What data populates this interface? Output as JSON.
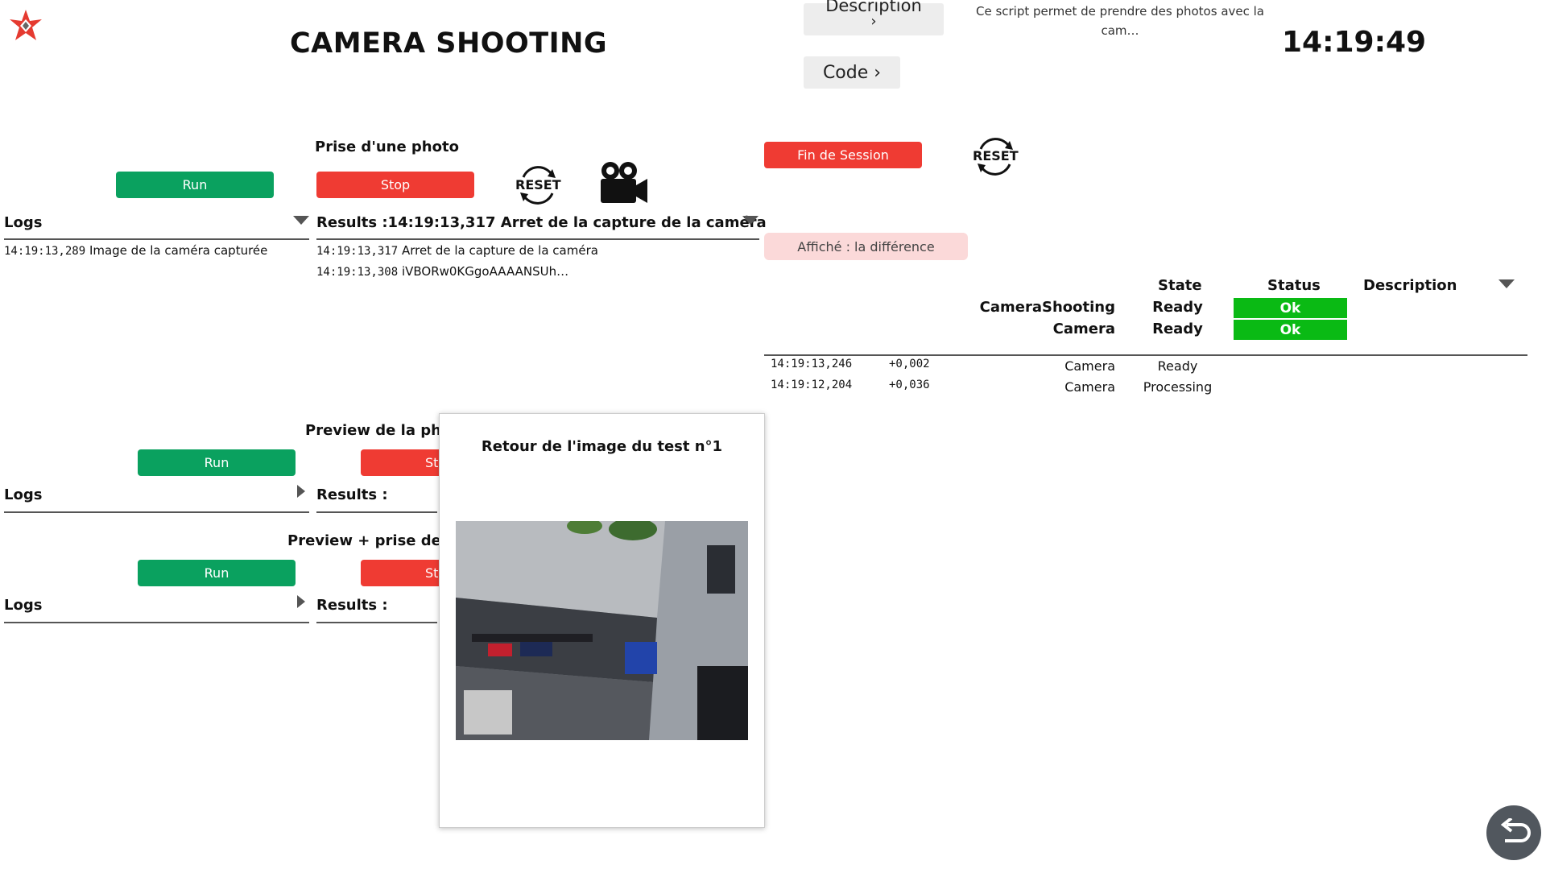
{
  "header": {
    "title": "CAMERA SHOOTING",
    "description_label": "Description",
    "description_chevron": "›",
    "description_text": "Ce script permet de prendre des photos avec la cam…",
    "code_label": "Code ›",
    "clock": "14:19:49"
  },
  "section1": {
    "title": "Prise d'une photo",
    "run_label": "Run",
    "stop_label": "Stop",
    "reset_text": "RESET",
    "logs_label": "Logs",
    "logs": [
      {
        "time": "14:19:13,289",
        "text": "Image de la caméra capturée"
      }
    ],
    "results_label": "Results :14:19:13,317 Arret de la capture de la caméra",
    "results": [
      {
        "time": "14:19:13,317",
        "text": "Arret de la capture de la caméra"
      },
      {
        "time": "14:19:13,308",
        "text": "iVBORw0KGgoAAAANSUh…"
      }
    ]
  },
  "section2": {
    "title": "Preview de la pho",
    "run_label": "Run",
    "stop_label": "St",
    "logs_label": "Logs",
    "results_label": "Results :"
  },
  "section3": {
    "title": "Preview + prise de p",
    "run_label": "Run",
    "stop_label": "St",
    "logs_label": "Logs",
    "results_label": "Results :"
  },
  "session": {
    "end_label": "Fin de Session",
    "reset_text": "RESET",
    "diff_label": "Affiché : la différence"
  },
  "status_table": {
    "headers": {
      "state": "State",
      "status": "Status",
      "description": "Description"
    },
    "rows": [
      {
        "name": "CameraShooting",
        "state": "Ready",
        "status": "Ok"
      },
      {
        "name": "Camera",
        "state": "Ready",
        "status": "Ok"
      }
    ],
    "log": [
      {
        "time": "14:19:13,246",
        "delta": "+0,002",
        "source": "Camera",
        "state": "Ready"
      },
      {
        "time": "14:19:12,204",
        "delta": "+0,036",
        "source": "Camera",
        "state": "Processing"
      }
    ]
  },
  "popup": {
    "title": "Retour de l'image du test n°1"
  },
  "colors": {
    "green": "#0aa15f",
    "red": "#ef3b33",
    "ok": "#0aba14",
    "pink": "#fbd9d9"
  }
}
